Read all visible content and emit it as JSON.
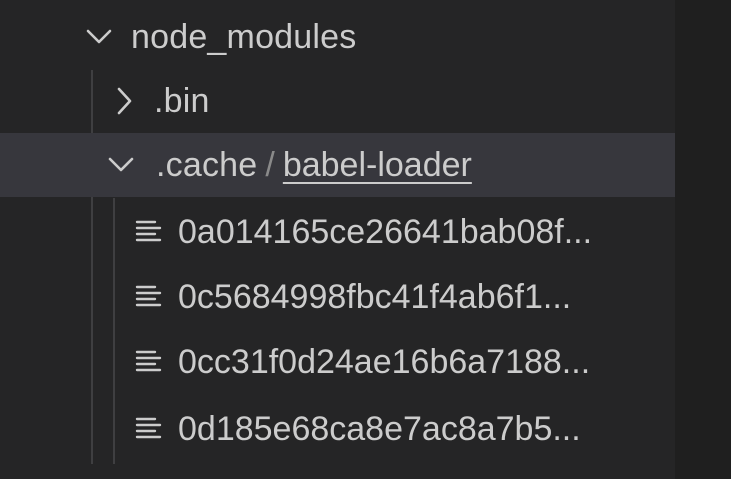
{
  "explorer": {
    "node_modules": {
      "label": "node_modules",
      "expanded": true,
      "icon": "chevron-down-icon"
    },
    "bin": {
      "label": ".bin",
      "expanded": false,
      "icon": "chevron-right-icon"
    },
    "cache": {
      "label": ".cache",
      "separator": "/",
      "compact_child": "babel-loader",
      "expanded": true,
      "icon": "chevron-down-icon"
    },
    "files": [
      {
        "label": "0a014165ce26641bab08f...",
        "icon": "file-lines-icon"
      },
      {
        "label": "0c5684998fbc41f4ab6f1...",
        "icon": "file-lines-icon"
      },
      {
        "label": "0cc31f0d24ae16b6a7188...",
        "icon": "file-lines-icon"
      },
      {
        "label": "0d185e68ca8e7ac8a7b5...",
        "icon": "file-lines-icon"
      }
    ]
  },
  "colors": {
    "background": "#252526",
    "focused_row": "#37373d",
    "text": "#cccccc",
    "indent_guide": "#3f3f41"
  }
}
